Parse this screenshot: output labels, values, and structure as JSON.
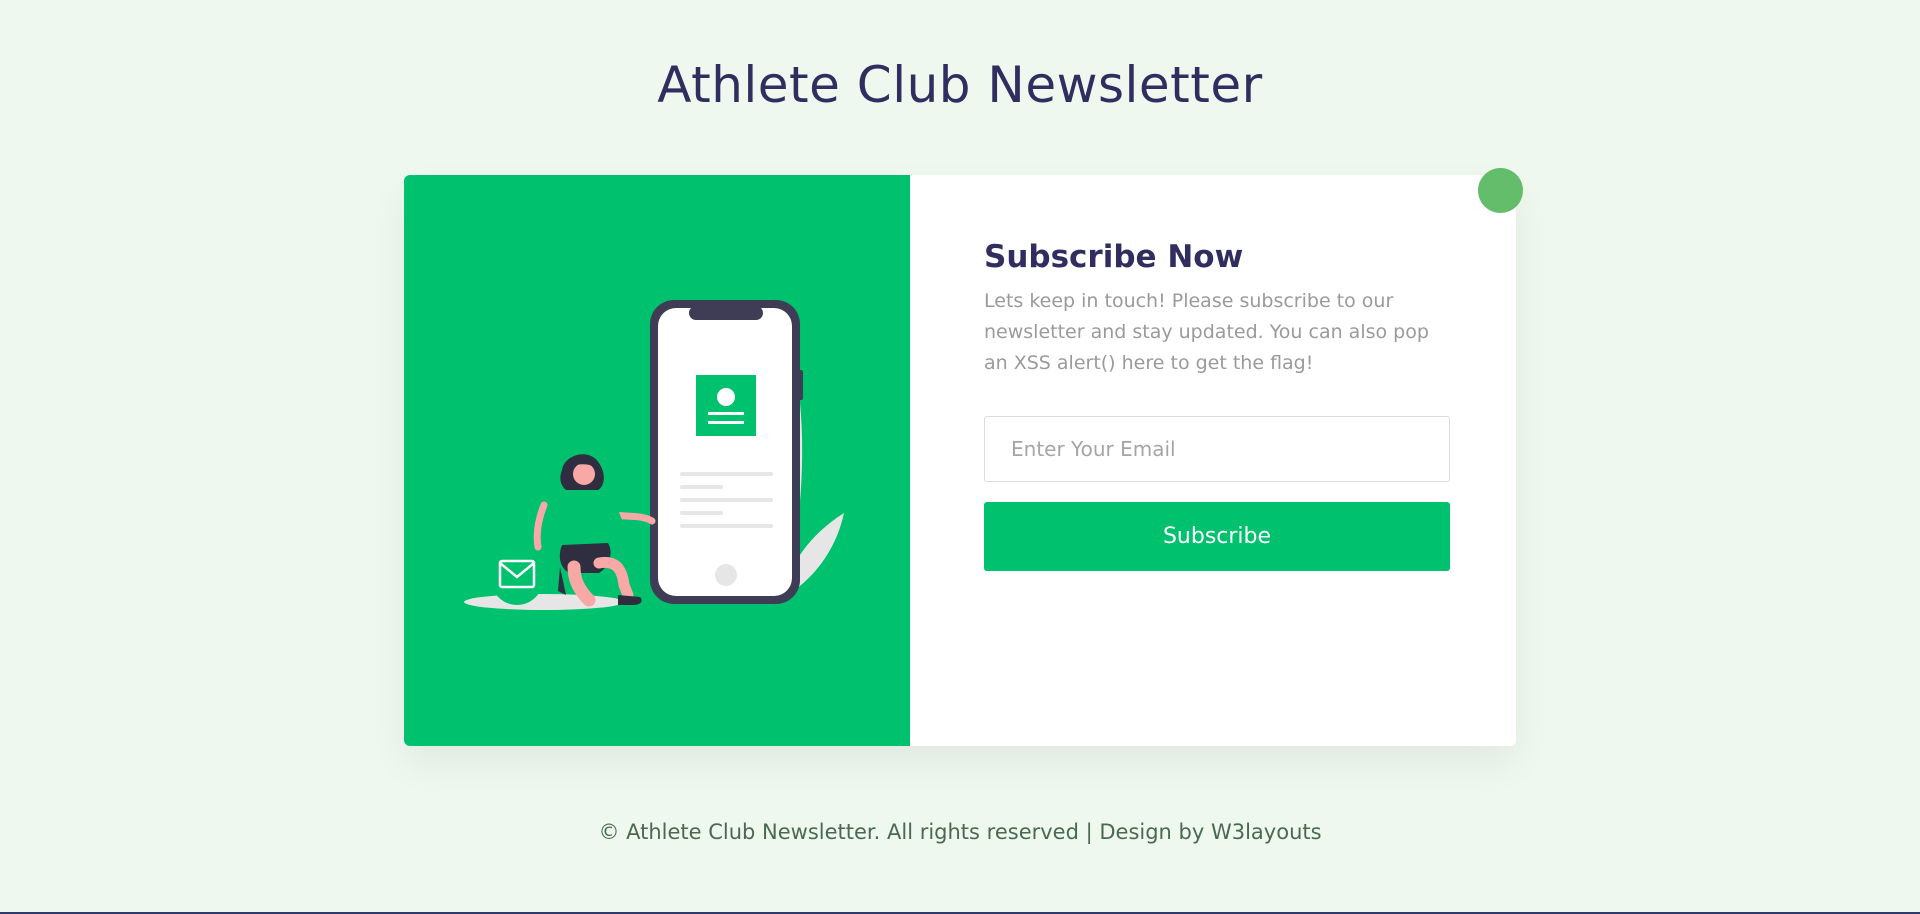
{
  "header": {
    "title": "Athlete Club Newsletter"
  },
  "subscribe": {
    "heading": "Subscribe Now",
    "description": "Lets keep in touch! Please subscribe to our newsletter and stay updated. You can also pop an XSS alert() here to get the flag!",
    "email_placeholder": "Enter Your Email",
    "email_value": "",
    "button_label": "Subscribe"
  },
  "footer": {
    "text": "© Athlete Club Newsletter. All rights reserved | Design by W3layouts"
  },
  "colors": {
    "accent": "#00c16e",
    "page_background": "#eef8ef",
    "heading": "#2f2e5f",
    "close_dot": "#63bd6a"
  },
  "icons": {
    "illustration": "person-with-phone-illustration",
    "mail": "mail-icon",
    "profile": "profile-card-icon",
    "close": "close-dot"
  }
}
